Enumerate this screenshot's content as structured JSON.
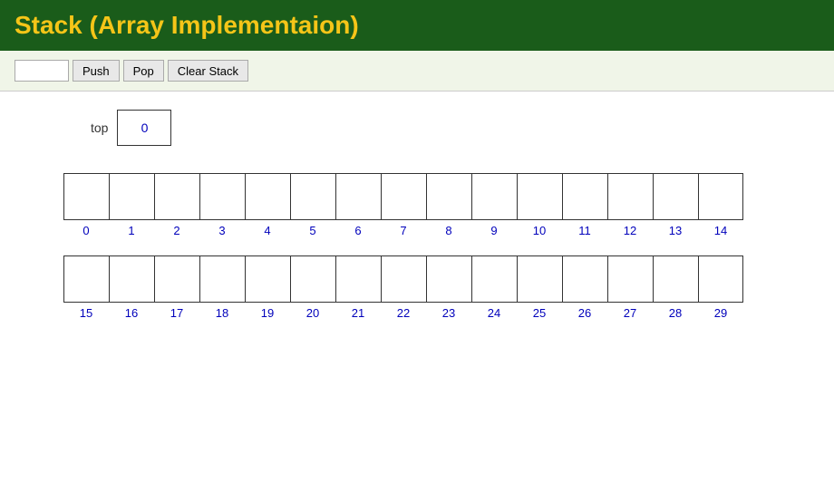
{
  "header": {
    "title": "Stack (Array Implementaion)"
  },
  "toolbar": {
    "input_placeholder": "",
    "input_value": "",
    "push_label": "Push",
    "pop_label": "Pop",
    "clear_label": "Clear Stack"
  },
  "top_indicator": {
    "label": "top",
    "value": "0"
  },
  "row1": {
    "cells": [
      "",
      "",
      "",
      "",
      "",
      "",
      "",
      "",
      "",
      "",
      "",
      "",
      "",
      "",
      ""
    ],
    "labels": [
      "0",
      "1",
      "2",
      "3",
      "4",
      "5",
      "6",
      "7",
      "8",
      "9",
      "10",
      "11",
      "12",
      "13",
      "14"
    ]
  },
  "row2": {
    "cells": [
      "",
      "",
      "",
      "",
      "",
      "",
      "",
      "",
      "",
      "",
      "",
      "",
      "",
      "",
      ""
    ],
    "labels": [
      "15",
      "16",
      "17",
      "18",
      "19",
      "20",
      "21",
      "22",
      "23",
      "24",
      "25",
      "26",
      "27",
      "28",
      "29"
    ]
  }
}
